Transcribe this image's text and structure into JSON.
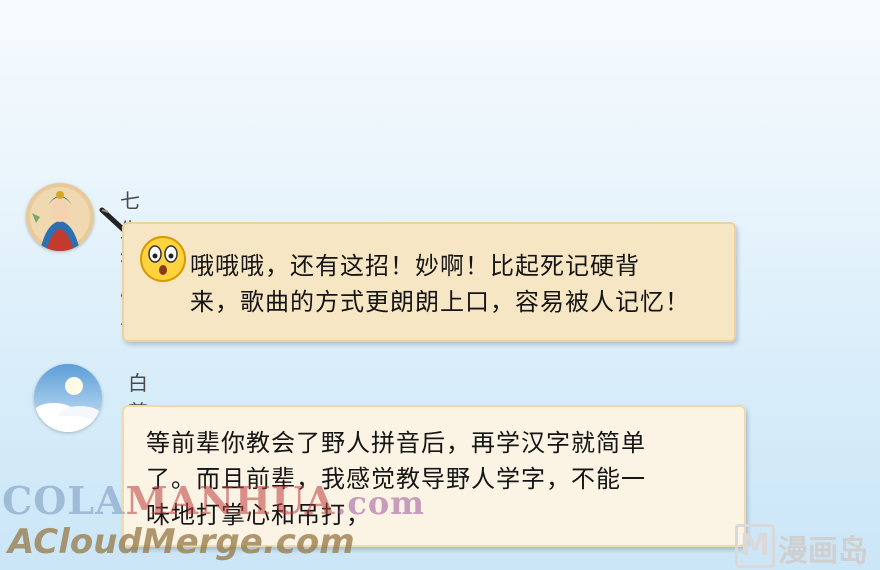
{
  "messages": [
    {
      "sender": "七生符府主",
      "text": "哦哦哦，还有这招！妙啊！比起死记硬背\n来，歌曲的方式更朗朗上口，容易被人记忆！"
    },
    {
      "sender": "白尊者",
      "text": "等前辈你教会了野人拼音后，再学汉字就简单\n了。而且前辈，我感觉教导野人学字，不能一\n味地打掌心和吊打，"
    }
  ],
  "watermarks": {
    "colamanhua_a": "COLA",
    "colamanhua_b": "MANHUA",
    "colamanhua_c": ".com",
    "acloudmerge": "ACloudMerge.com",
    "logo_letter": "M",
    "logo_text": "漫画岛"
  },
  "icons": {
    "emoji": "shocked-face-icon",
    "brush": "brush-pen-icon"
  }
}
